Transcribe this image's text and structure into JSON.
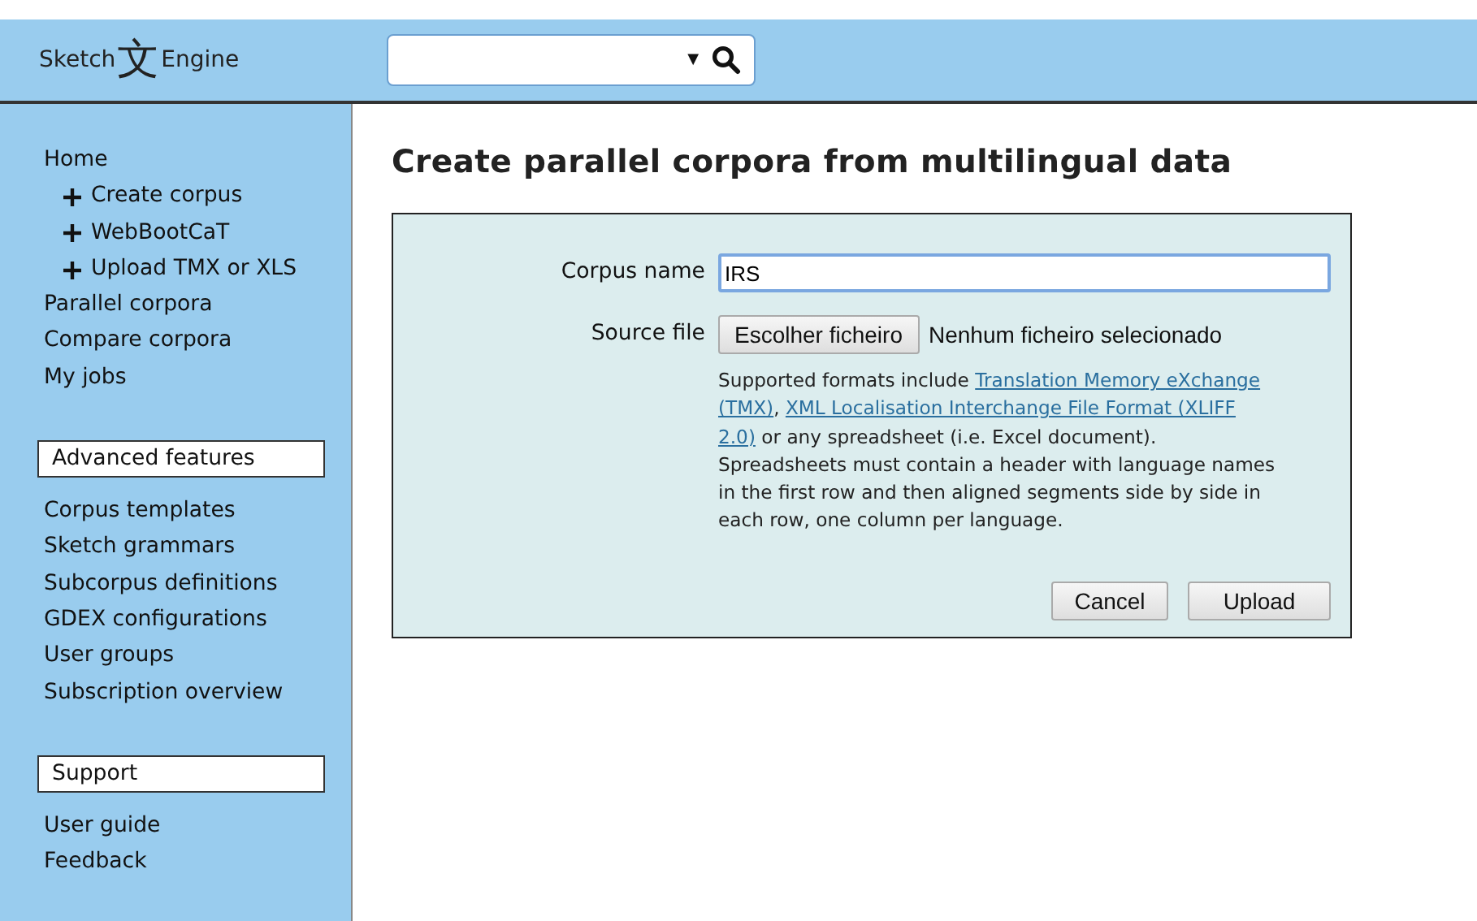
{
  "logo": {
    "left": "Sketch",
    "mark": "文",
    "right": "Engine"
  },
  "search": {
    "dropdown_glyph": "▼"
  },
  "sidebar": {
    "groups": [
      {
        "items": [
          {
            "label": "Home",
            "children": [
              {
                "label": "Create corpus"
              },
              {
                "label": "WebBootCaT"
              },
              {
                "label": "Upload TMX or XLS"
              }
            ]
          },
          {
            "label": "Parallel corpora"
          },
          {
            "label": "Compare corpora"
          },
          {
            "label": "My jobs"
          }
        ]
      },
      {
        "heading": "Advanced features",
        "items": [
          {
            "label": "Corpus templates"
          },
          {
            "label": "Sketch grammars"
          },
          {
            "label": "Subcorpus definitions"
          },
          {
            "label": "GDEX configurations"
          },
          {
            "label": "User groups"
          },
          {
            "label": "Subscription overview"
          }
        ]
      },
      {
        "heading": "Support",
        "items": [
          {
            "label": "User guide"
          },
          {
            "label": "Feedback"
          }
        ]
      }
    ]
  },
  "page_title": "Create parallel corpora from multilingual data",
  "form": {
    "corpus_name": {
      "label": "Corpus name",
      "value": "IRS"
    },
    "source_file": {
      "label": "Source file",
      "button": "Escolher ficheiro",
      "status": "Nenhum ficheiro selecionado"
    },
    "help": [
      [
        {
          "kind": "text",
          "text": "Supported formats include "
        },
        {
          "kind": "link",
          "text": "Translation Memory eXchange"
        }
      ],
      [
        {
          "kind": "link",
          "text": "(TMX)"
        },
        {
          "kind": "text",
          "text": ", "
        },
        {
          "kind": "link",
          "text": "XML Localisation Interchange File Format (XLIFF"
        }
      ],
      [
        {
          "kind": "link",
          "text": "2.0)"
        },
        {
          "kind": "text",
          "text": " or any spreadsheet (i.e. Excel document)."
        }
      ],
      [
        {
          "kind": "text",
          "text": "Spreadsheets must contain a header with language names"
        }
      ],
      [
        {
          "kind": "text",
          "text": "in the first row and then aligned segments side by side in"
        }
      ],
      [
        {
          "kind": "text",
          "text": "each row, one column per language."
        }
      ]
    ],
    "buttons": [
      "Cancel",
      "Upload"
    ]
  }
}
